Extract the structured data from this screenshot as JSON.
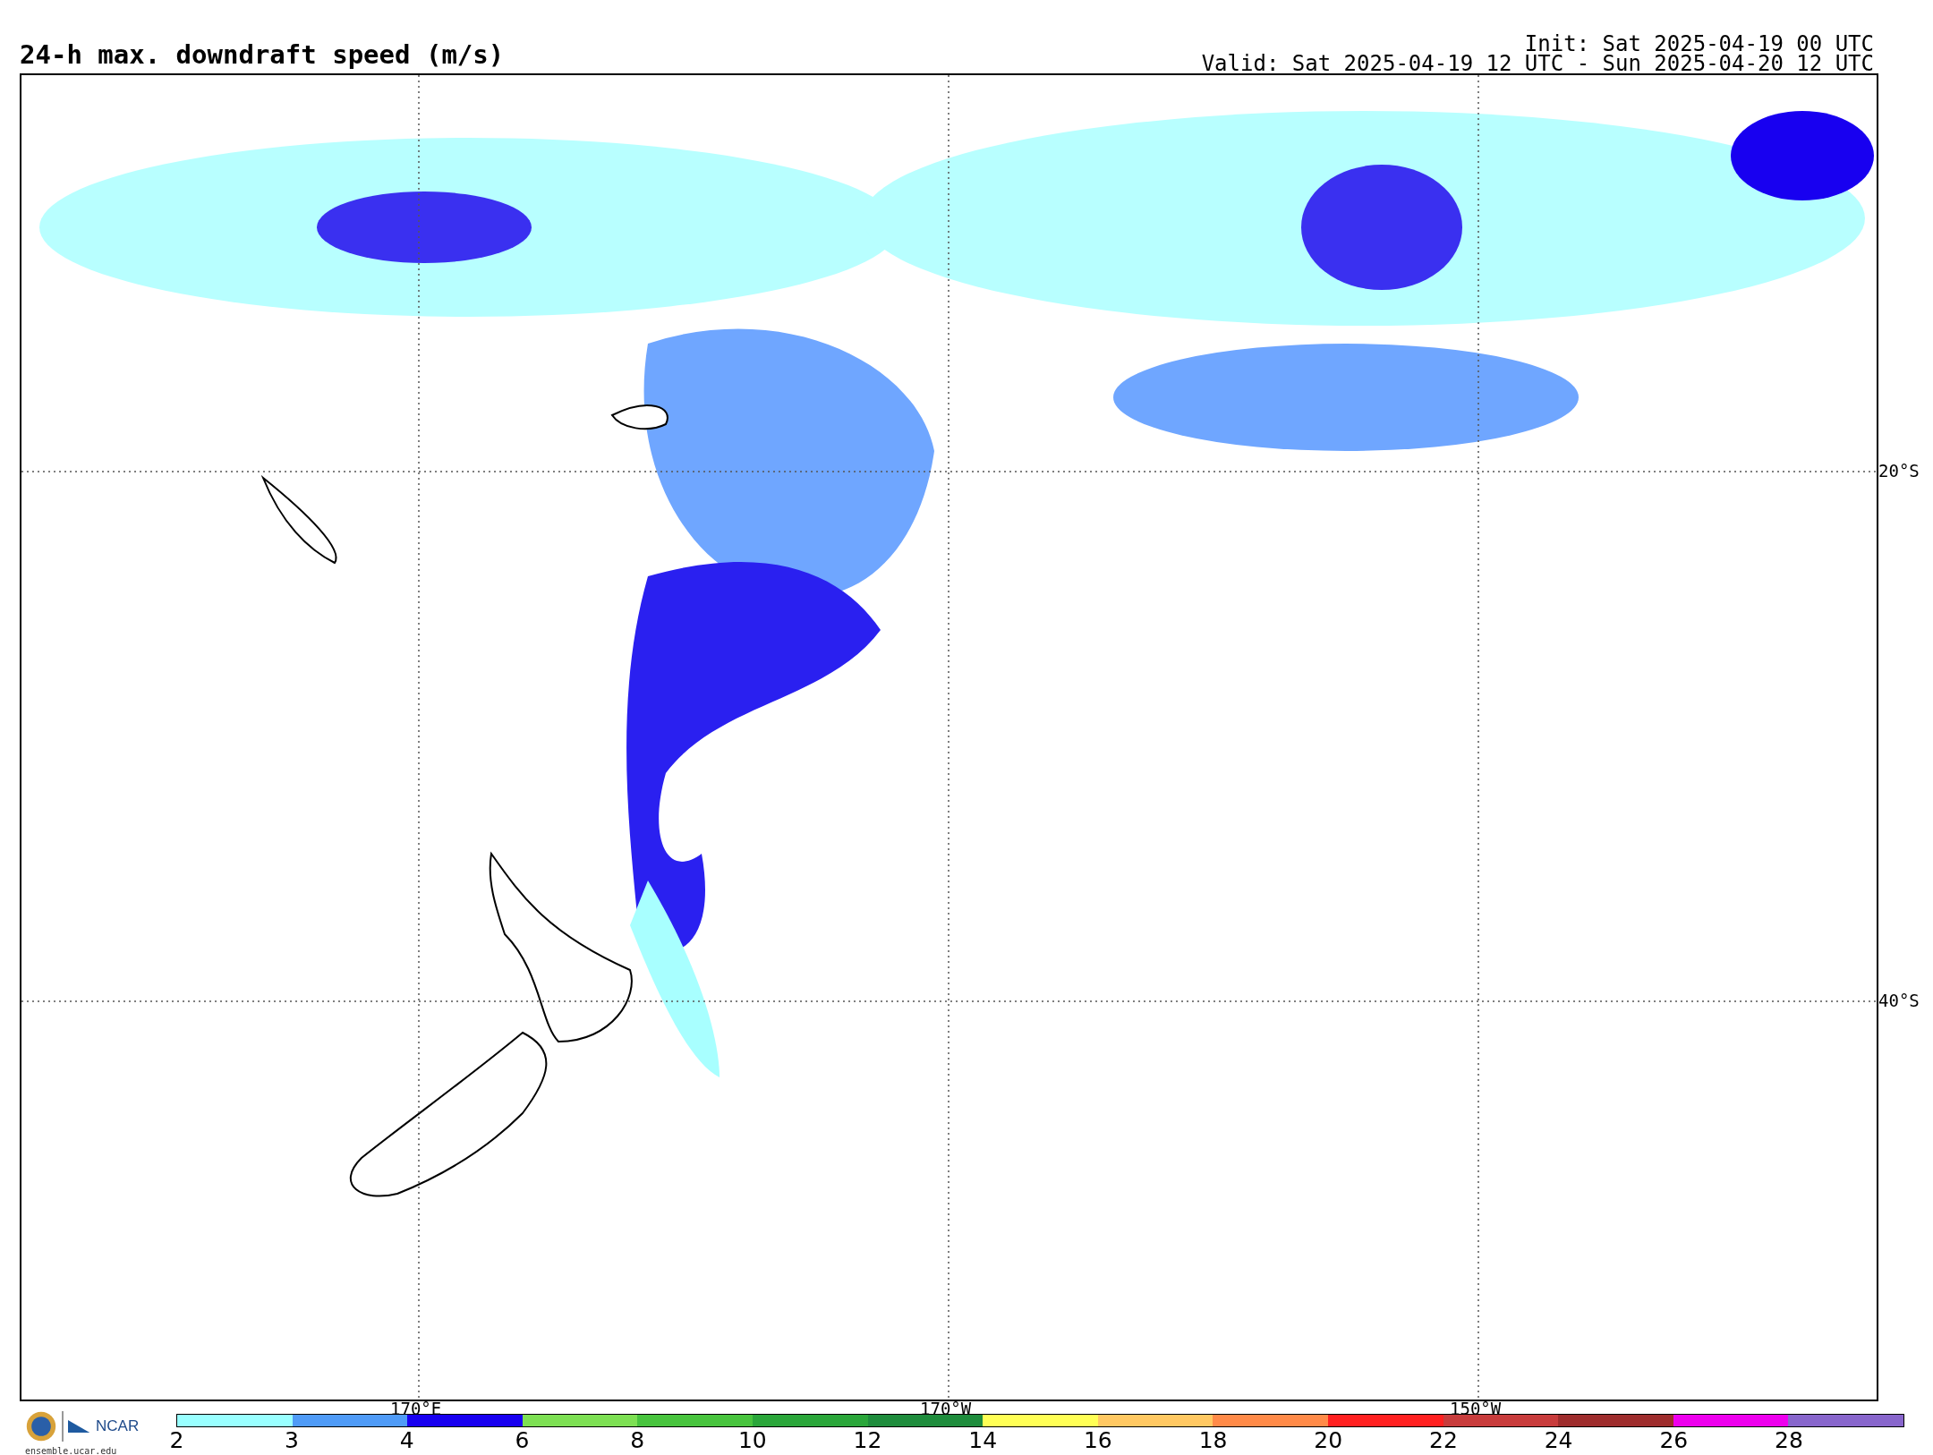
{
  "title": "24-h max. downdraft speed (m/s)",
  "init": "Init: Sat 2025-04-19 00 UTC",
  "valid": "Valid: Sat 2025-04-19 12 UTC - Sun 2025-04-20 12 UTC",
  "map": {
    "lat_labels": [
      "20°S",
      "40°S"
    ],
    "lon_labels": [
      "170°E",
      "170°W",
      "150°W"
    ]
  },
  "colorbar": {
    "bins": [
      {
        "color": "#99ffff"
      },
      {
        "color": "#4f9bf7"
      },
      {
        "color": "#1800f0"
      },
      {
        "color": "#7de053"
      },
      {
        "color": "#48c43e"
      },
      {
        "color": "#2aa63a"
      },
      {
        "color": "#1e8c3c"
      },
      {
        "color": "#ffff55"
      },
      {
        "color": "#ffc862"
      },
      {
        "color": "#ff8a48"
      },
      {
        "color": "#ff2020"
      },
      {
        "color": "#c83c3c"
      },
      {
        "color": "#9e2c2c"
      },
      {
        "color": "#ee00ee"
      },
      {
        "color": "#8866cc"
      }
    ],
    "ticks": [
      "2",
      "3",
      "4",
      "6",
      "8",
      "10",
      "12",
      "14",
      "16",
      "18",
      "20",
      "22",
      "24",
      "26",
      "28"
    ]
  },
  "footer": {
    "logo_text": "NCAR",
    "site": "ensemble.ucar.edu"
  }
}
